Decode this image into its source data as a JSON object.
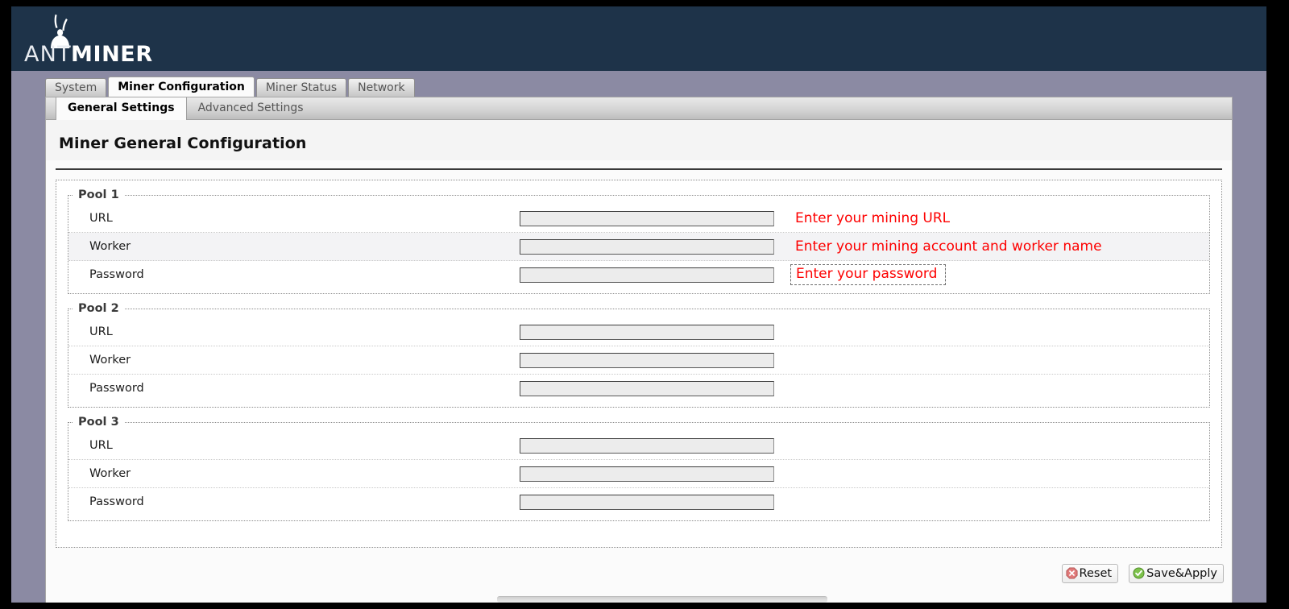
{
  "brand": {
    "name_light": "ANT",
    "name_bold": "MINER",
    "logo_icon": "ant-logo-icon",
    "bar_color": "#1e3349"
  },
  "tabs": [
    {
      "label": "System",
      "active": false
    },
    {
      "label": "Miner Configuration",
      "active": true
    },
    {
      "label": "Miner Status",
      "active": false
    },
    {
      "label": "Network",
      "active": false
    }
  ],
  "subtabs": [
    {
      "label": "General Settings",
      "active": true
    },
    {
      "label": "Advanced Settings",
      "active": false
    }
  ],
  "page": {
    "title": "Miner General Configuration"
  },
  "pools": [
    {
      "legend": "Pool 1",
      "rows": [
        {
          "label": "URL",
          "value": "",
          "placeholder": "",
          "alt": false,
          "note": "Enter your mining URL",
          "note_boxed": false
        },
        {
          "label": "Worker",
          "value": "",
          "placeholder": "",
          "alt": true,
          "note": "Enter your mining account and worker name",
          "note_boxed": false
        },
        {
          "label": "Password",
          "value": "",
          "placeholder": "",
          "alt": false,
          "note": "Enter your password",
          "note_boxed": true
        }
      ]
    },
    {
      "legend": "Pool 2",
      "rows": [
        {
          "label": "URL",
          "value": "",
          "placeholder": "",
          "alt": false,
          "note": "",
          "note_boxed": false
        },
        {
          "label": "Worker",
          "value": "",
          "placeholder": "",
          "alt": false,
          "note": "",
          "note_boxed": false
        },
        {
          "label": "Password",
          "value": "",
          "placeholder": "",
          "alt": false,
          "note": "",
          "note_boxed": false
        }
      ]
    },
    {
      "legend": "Pool 3",
      "rows": [
        {
          "label": "URL",
          "value": "",
          "placeholder": "",
          "alt": false,
          "note": "",
          "note_boxed": false
        },
        {
          "label": "Worker",
          "value": "",
          "placeholder": "",
          "alt": false,
          "note": "",
          "note_boxed": false
        },
        {
          "label": "Password",
          "value": "",
          "placeholder": "",
          "alt": false,
          "note": "",
          "note_boxed": false
        }
      ]
    }
  ],
  "footer": {
    "reset_label": "Reset",
    "reset_icon": "reset-octagon-x-icon",
    "save_label": "Save&Apply",
    "save_icon": "save-check-circle-icon"
  },
  "colors": {
    "annotation_red": "#fd0000",
    "chrome_purple": "#8b8aa3",
    "reset_red": "#e07a7a",
    "save_green": "#7dc24b"
  }
}
